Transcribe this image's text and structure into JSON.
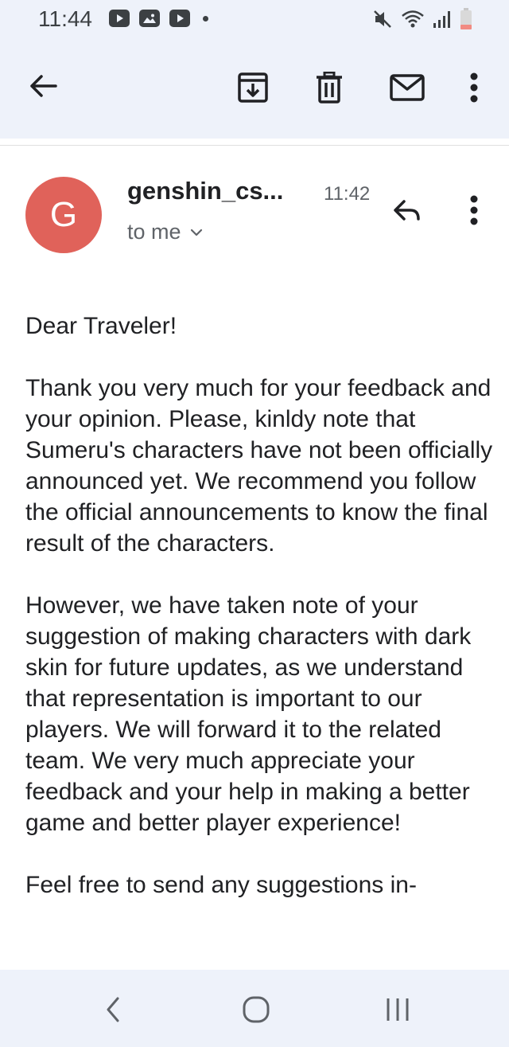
{
  "status_bar": {
    "time": "11:44",
    "left_icons": [
      "youtube-icon",
      "gallery-icon",
      "youtube-icon",
      "dot-icon"
    ],
    "right_icons": [
      "mute-icon",
      "wifi-icon",
      "signal-icon",
      "battery-low-icon"
    ]
  },
  "toolbar": {
    "back_icon": "arrow-back-icon",
    "actions": [
      "archive-icon",
      "trash-icon",
      "mail-unread-icon",
      "more-vert-icon"
    ]
  },
  "message": {
    "avatar_letter": "G",
    "avatar_color": "#e0625a",
    "sender": "genshin_cs...",
    "time": "11:42",
    "recipient": "to me",
    "paragraphs": [
      "Dear Traveler!",
      "Thank you very much for your feedback and your opinion. Please, kinldy note that Sumeru's characters have not been officially announced yet. We recommend you follow the official announcements to know the final result of the characters.",
      "However, we have taken note of your suggestion of making characters with dark skin for future updates, as we understand that representation is important to our players. We will forward it to the related team. We very much appreciate your feedback and your help in making a better game and better player experience!",
      "Feel free to send any suggestions in-"
    ]
  },
  "nav_bar": {
    "buttons": [
      "back-nav-icon",
      "home-nav-icon",
      "recents-nav-icon"
    ]
  },
  "colors": {
    "header_bg": "#eef2fa",
    "text": "#202124",
    "secondary_text": "#5f6368"
  }
}
